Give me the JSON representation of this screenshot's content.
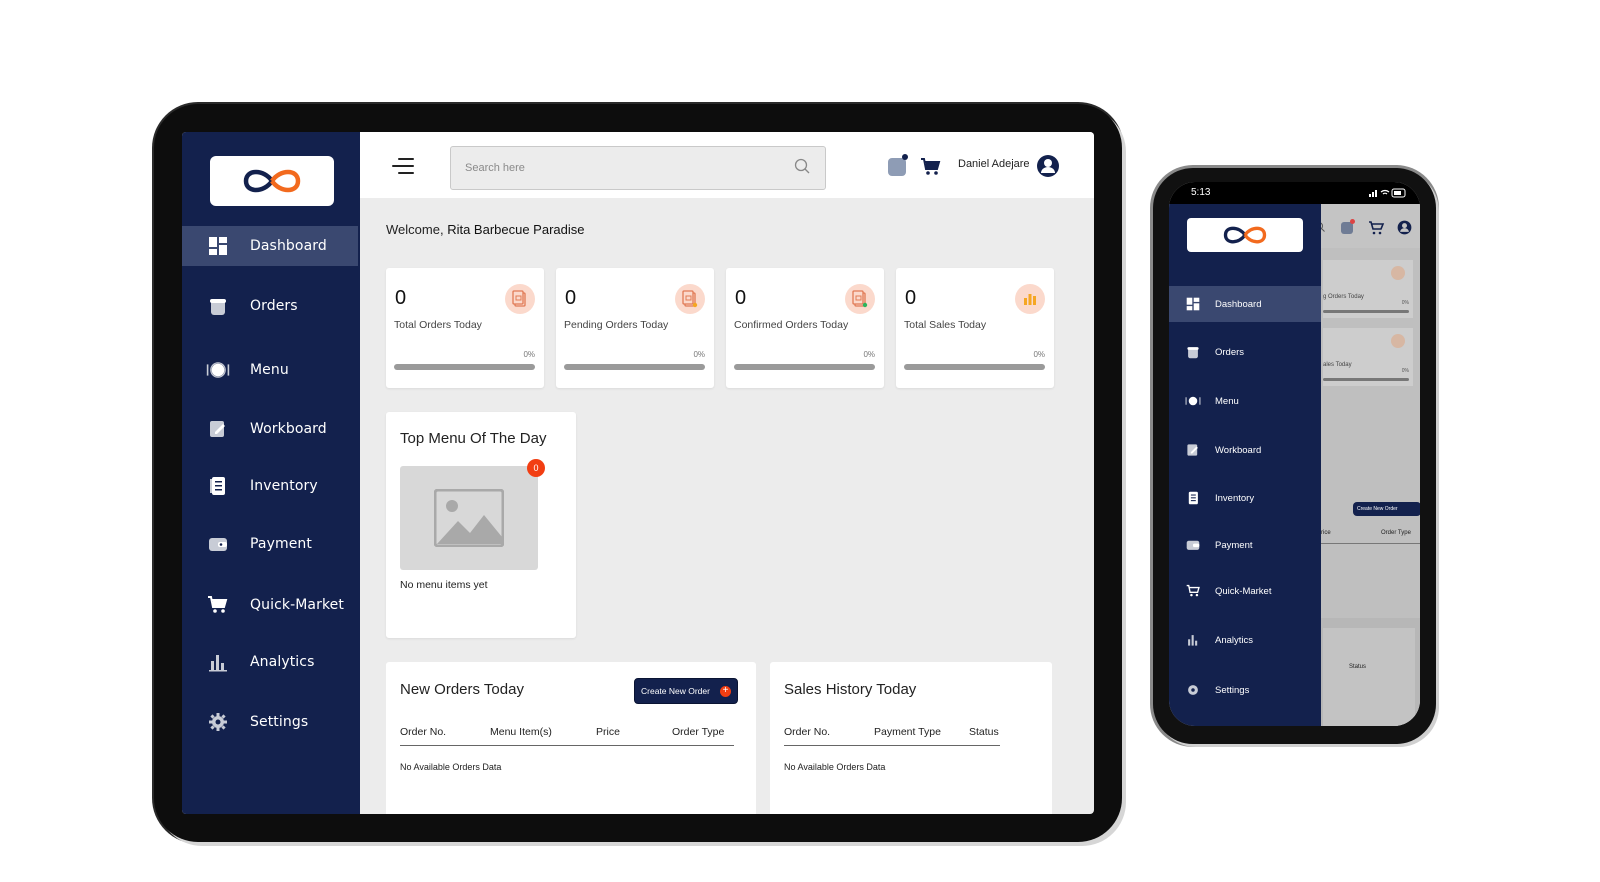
{
  "colors": {
    "sidebar": "#13214d",
    "accent": "#f23e12",
    "badge_bg": "#fbd9cc"
  },
  "tablet": {
    "sidebar": {
      "items": [
        {
          "label": "Dashboard",
          "icon": "dashboard-icon",
          "active": true
        },
        {
          "label": "Orders",
          "icon": "orders-basket-icon"
        },
        {
          "label": "Menu",
          "icon": "plate-cutlery-icon"
        },
        {
          "label": "Workboard",
          "icon": "workboard-pencil-icon"
        },
        {
          "label": "Inventory",
          "icon": "inventory-document-icon"
        },
        {
          "label": "Payment",
          "icon": "wallet-icon"
        },
        {
          "label": "Quick-Market",
          "icon": "shopping-cart-icon"
        },
        {
          "label": "Analytics",
          "icon": "bar-chart-icon"
        },
        {
          "label": "Settings",
          "icon": "gear-icon"
        }
      ]
    },
    "header": {
      "search_placeholder": "Search here",
      "user_name": "Daniel Adejare"
    },
    "welcome": {
      "prefix": "Welcome,",
      "name": "Rita Barbecue Paradise"
    },
    "stats": [
      {
        "value": "0",
        "label": "Total Orders Today",
        "percent": "0%",
        "progress": 0,
        "icon": "orders-document-icon"
      },
      {
        "value": "0",
        "label": "Pending Orders Today",
        "percent": "0%",
        "progress": 0,
        "icon": "pending-document-icon"
      },
      {
        "value": "0",
        "label": "Confirmed Orders Today",
        "percent": "0%",
        "progress": 0,
        "icon": "confirmed-document-icon"
      },
      {
        "value": "0",
        "label": "Total Sales Today",
        "percent": "0%",
        "progress": 0,
        "icon": "sales-chart-icon"
      }
    ],
    "top_menu": {
      "title": "Top Menu Of The Day",
      "count": "0",
      "empty": "No menu items yet"
    },
    "new_orders": {
      "title": "New Orders Today",
      "create_button": "Create New Order",
      "columns": [
        "Order No.",
        "Menu Item(s)",
        "Price",
        "Order Type"
      ],
      "empty": "No Available Orders Data"
    },
    "sales_history": {
      "title": "Sales History Today",
      "columns": [
        "Order No.",
        "Payment Type",
        "Status"
      ],
      "empty": "No Available Orders Data"
    }
  },
  "phone": {
    "time": "5:13",
    "sidebar": {
      "items": [
        {
          "label": "Dashboard",
          "active": true
        },
        {
          "label": "Orders"
        },
        {
          "label": "Menu"
        },
        {
          "label": "Workboard"
        },
        {
          "label": "Inventory"
        },
        {
          "label": "Payment"
        },
        {
          "label": "Quick-Market"
        },
        {
          "label": "Analytics"
        },
        {
          "label": "Settings"
        }
      ]
    },
    "background": {
      "card1_label": "g Orders Today",
      "card2_label": "ales Today",
      "percent": "0%",
      "create_button": "Create New Order",
      "col_price": "rice",
      "col_order_type": "Order Type",
      "col_status": "Status"
    }
  }
}
